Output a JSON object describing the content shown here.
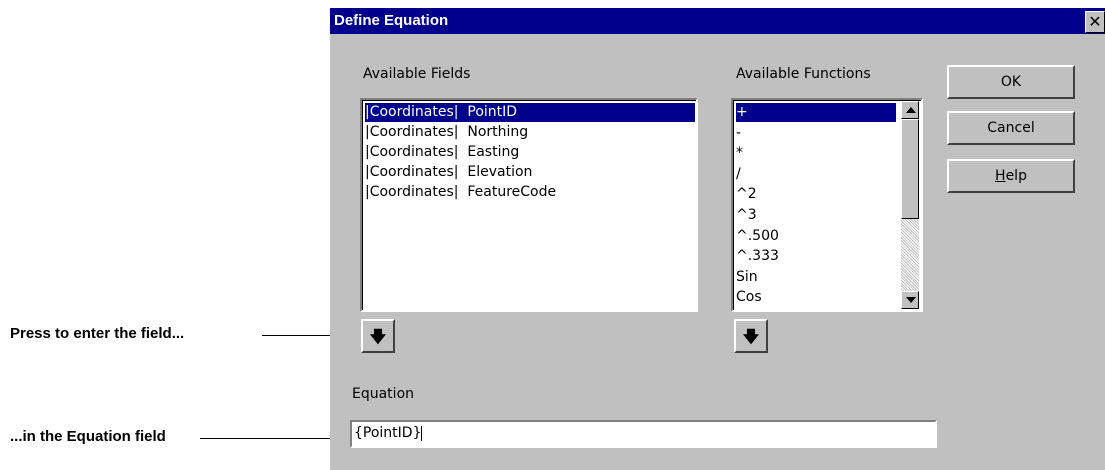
{
  "annotations": {
    "first": "Press to enter the field...",
    "second": "...in the Equation field"
  },
  "dialog": {
    "title": "Define Equation",
    "close_glyph": "✕",
    "available_fields_label": "Available Fields",
    "available_functions_label": "Available Functions",
    "fields": [
      "|Coordinates|  PointID",
      "|Coordinates|  Northing",
      "|Coordinates|  Easting",
      "|Coordinates|  Elevation",
      "|Coordinates|  FeatureCode"
    ],
    "selected_field_index": 0,
    "functions": [
      "+",
      "-",
      "*",
      "/",
      "^2",
      "^3",
      "^.500",
      "^.333",
      "Sin",
      "Cos"
    ],
    "selected_function_index": 0,
    "buttons": {
      "ok": "OK",
      "cancel": "Cancel",
      "help": "Help",
      "help_mnemonic": "H",
      "help_rest": "elp"
    },
    "insert_field_icon": "down-arrow-icon",
    "insert_function_icon": "down-arrow-icon",
    "equation_label": "Equation",
    "equation_value": "{PointID}"
  },
  "colors": {
    "title_bar": "#00008c",
    "dialog_bg": "#c0c0c0",
    "selection": "#00008c"
  }
}
